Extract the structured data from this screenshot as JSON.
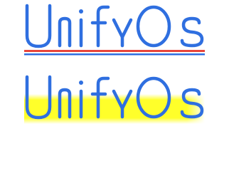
{
  "logos": [
    {
      "text": "UnifyOs",
      "variant": "underlined",
      "colors": {
        "letters": "#2f6fe0",
        "underline_top": "#e8453c",
        "underline_bottom": "#2f6fe0"
      }
    },
    {
      "text": "UnifyOs",
      "variant": "highlighted",
      "colors": {
        "letters": "#2f6fe0",
        "highlight": "#ffff2a"
      }
    }
  ]
}
